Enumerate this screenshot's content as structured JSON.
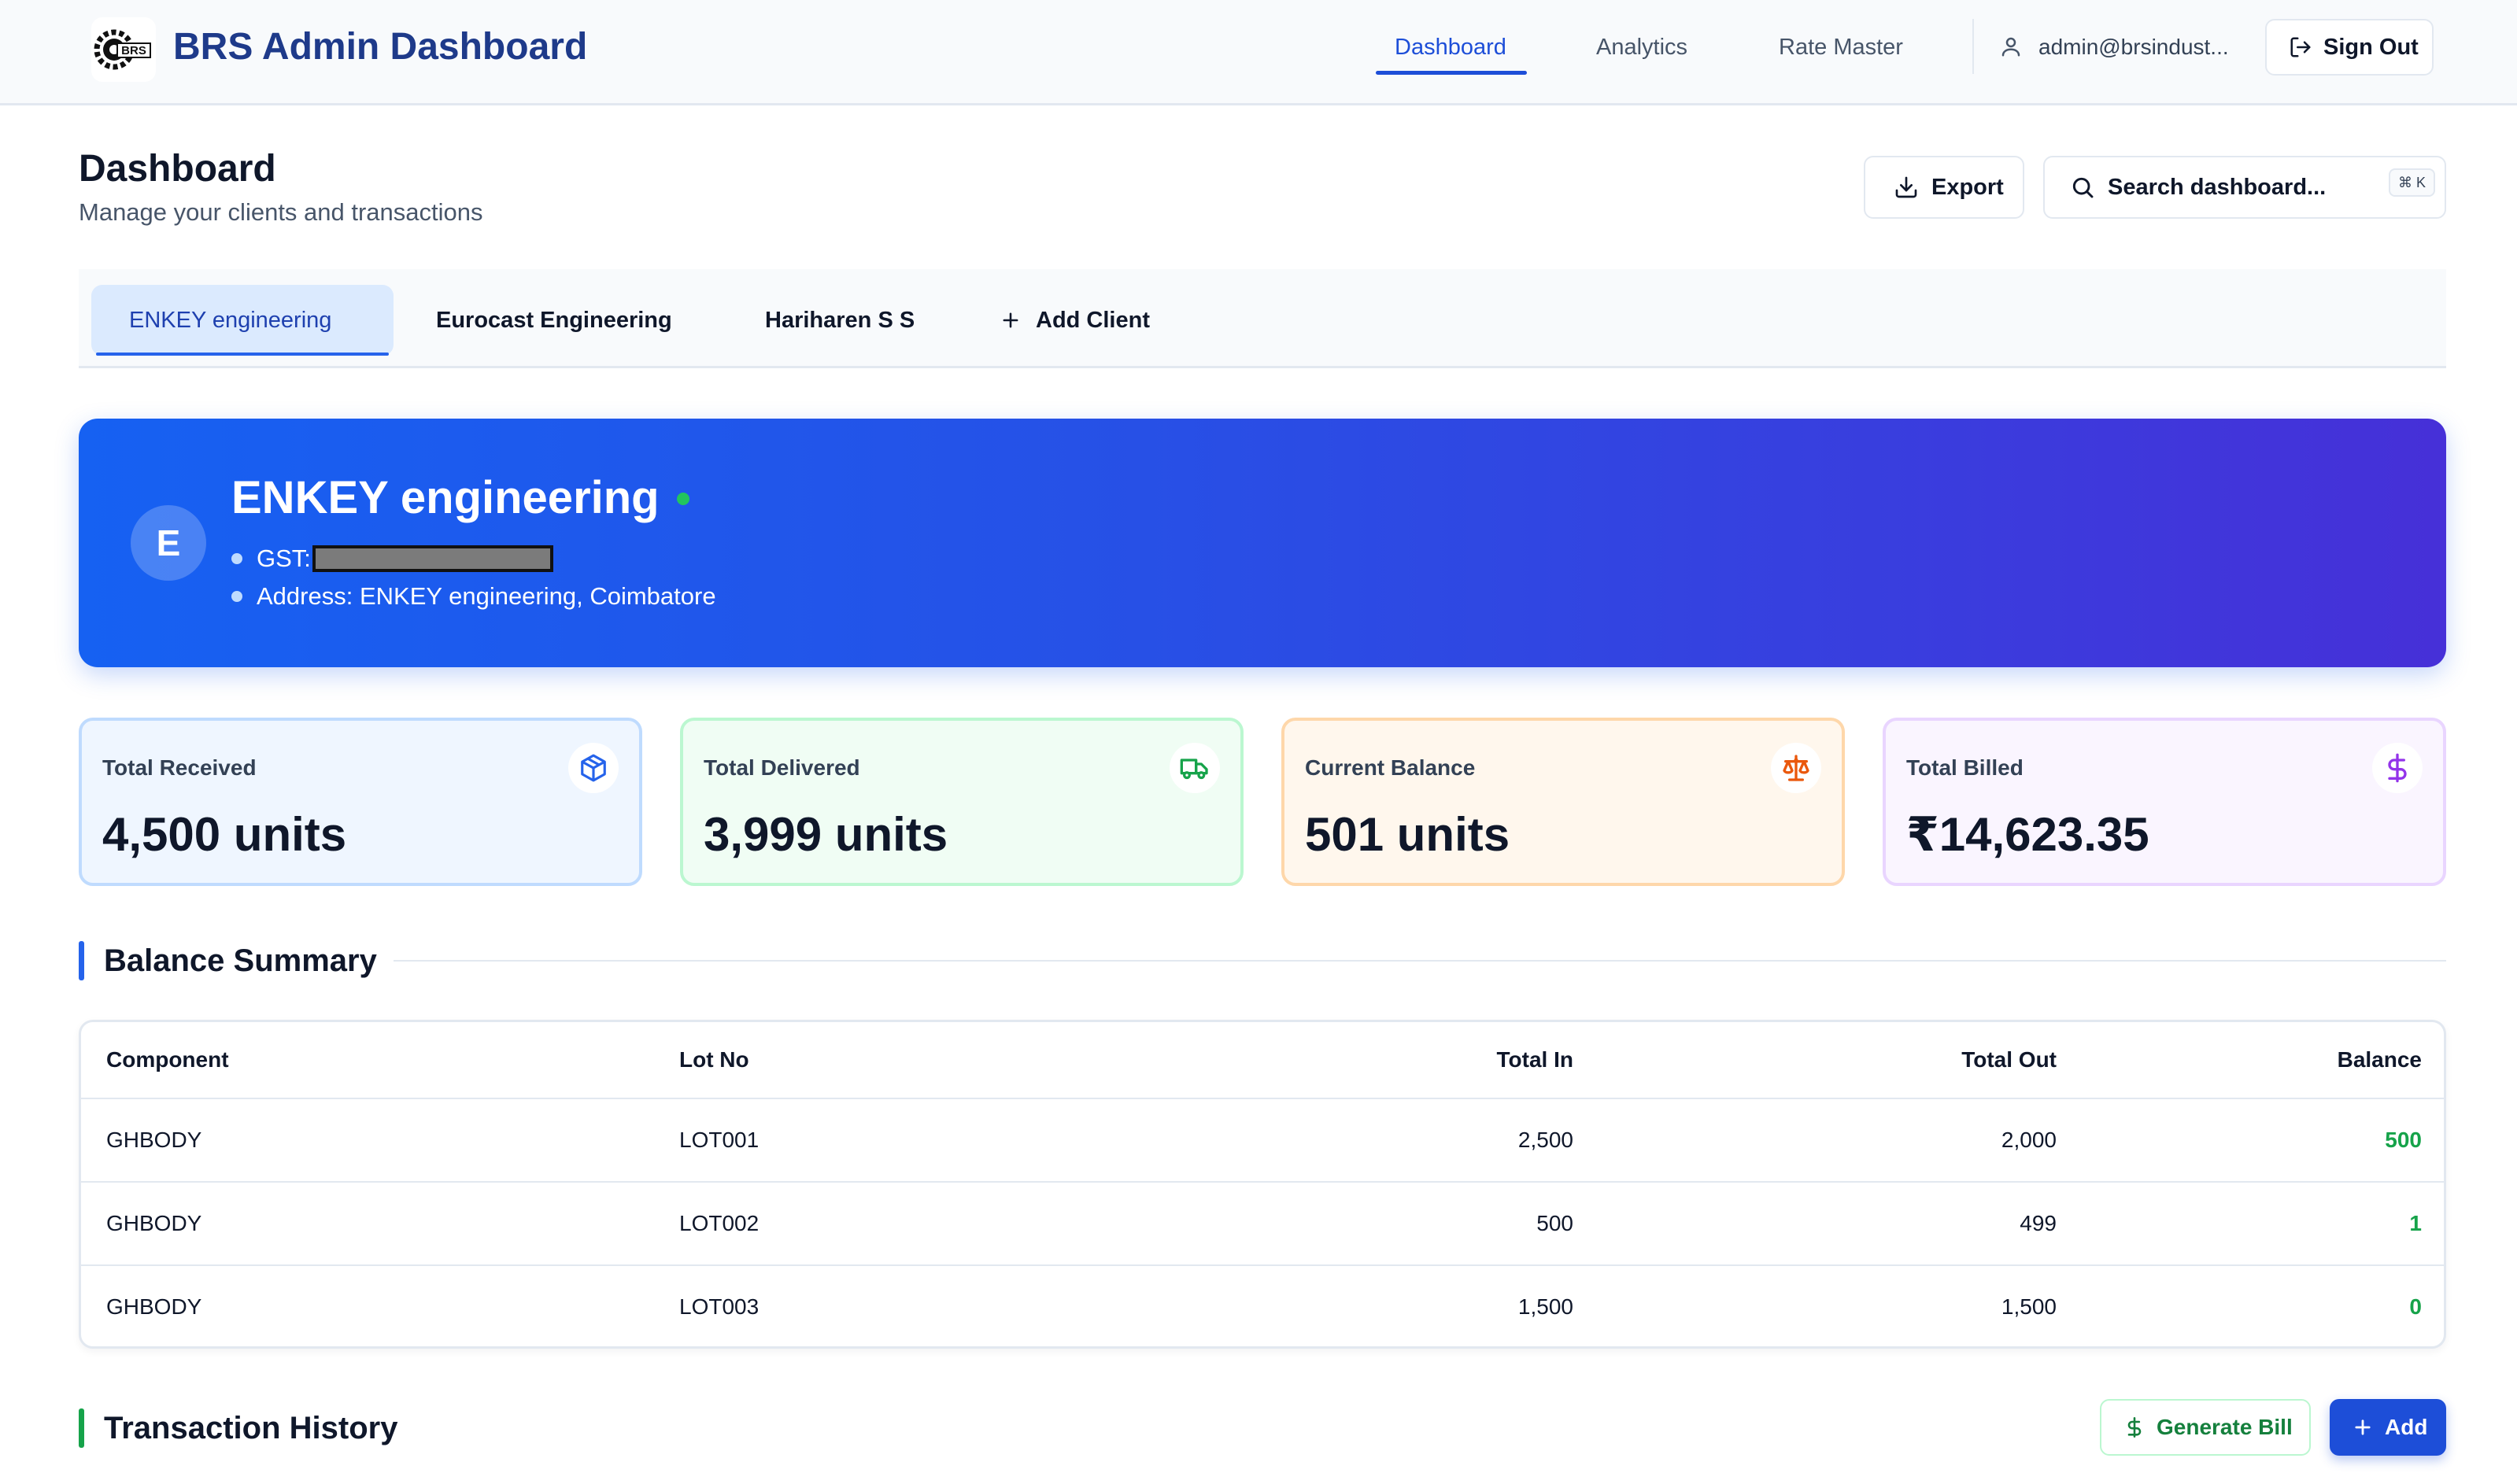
{
  "app": {
    "title": "BRS Admin Dashboard",
    "logo_text": "BRS"
  },
  "nav": {
    "links": [
      "Dashboard",
      "Analytics",
      "Rate Master"
    ],
    "active": "Dashboard",
    "user_email": "admin@brsindust...",
    "signout_label": "Sign Out"
  },
  "page": {
    "title": "Dashboard",
    "subtitle": "Manage your clients and transactions",
    "export_label": "Export",
    "search_placeholder": "Search dashboard...",
    "search_shortcut": "⌘ K"
  },
  "client_tabs": {
    "items": [
      "ENKEY engineering",
      "Eurocast Engineering",
      "Hariharen S S"
    ],
    "active": "ENKEY engineering",
    "add_label": "Add Client"
  },
  "client": {
    "initial": "E",
    "name": "ENKEY engineering",
    "gst_label": "GST:",
    "address": "Address: ENKEY engineering, Coimbatore"
  },
  "stats": [
    {
      "label": "Total Received",
      "value": "4,500 units",
      "icon": "box-icon",
      "accent": "#2563eb",
      "bg": "#eff6ff",
      "border": "#bfdbfe"
    },
    {
      "label": "Total Delivered",
      "value": "3,999 units",
      "icon": "truck-icon",
      "accent": "#16a34a",
      "bg": "#f0fdf4",
      "border": "#bbf7d0"
    },
    {
      "label": "Current Balance",
      "value": "501 units",
      "icon": "scale-icon",
      "accent": "#ea580c",
      "bg": "#fff7ed",
      "border": "#fed7aa"
    },
    {
      "label": "Total Billed",
      "value": "₹14,623.35",
      "icon": "dollar-icon",
      "accent": "#9333ea",
      "bg": "#faf5ff",
      "border": "#e9d5ff"
    }
  ],
  "balance_summary": {
    "title": "Balance Summary",
    "columns": [
      "Component",
      "Lot No",
      "Total In",
      "Total Out",
      "Balance"
    ],
    "rows": [
      {
        "component": "GHBODY",
        "lot": "LOT001",
        "in": "2,500",
        "out": "2,000",
        "balance": "500"
      },
      {
        "component": "GHBODY",
        "lot": "LOT002",
        "in": "500",
        "out": "499",
        "balance": "1"
      },
      {
        "component": "GHBODY",
        "lot": "LOT003",
        "in": "1,500",
        "out": "1,500",
        "balance": "0"
      }
    ]
  },
  "transaction_history": {
    "title": "Transaction History",
    "generate_bill_label": "Generate Bill",
    "add_label": "Add"
  },
  "colors": {
    "primary": "#1d4ed8",
    "success": "#16a34a",
    "summary_accent": "#2563eb",
    "history_accent": "#16a34a"
  }
}
